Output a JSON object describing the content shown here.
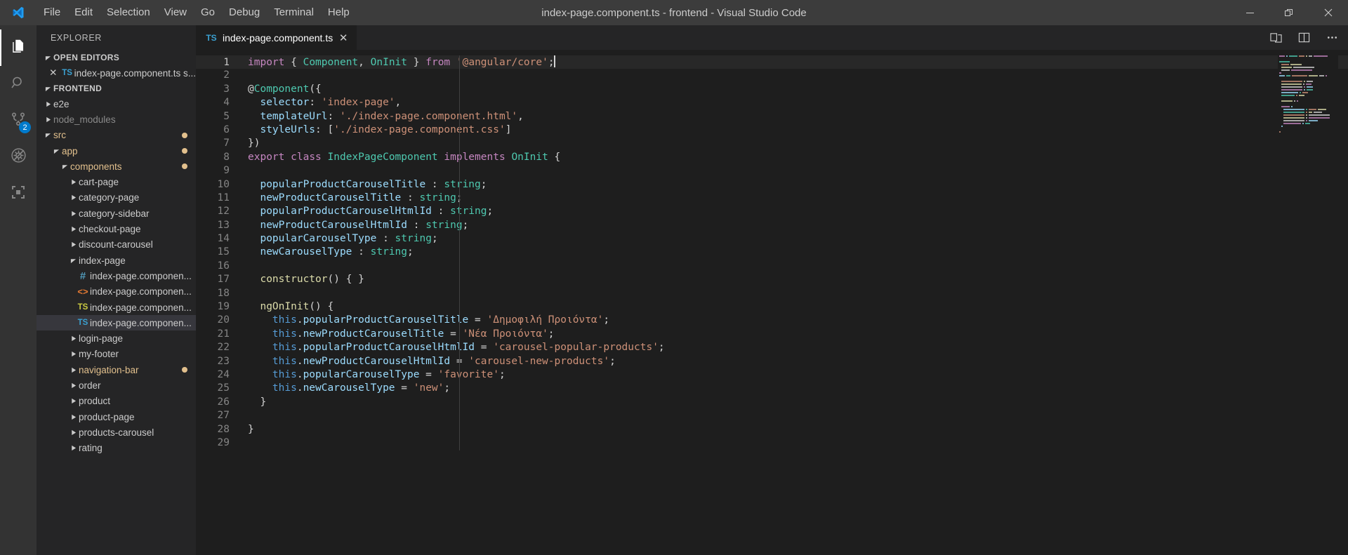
{
  "window": {
    "title": "index-page.component.ts - frontend - Visual Studio Code",
    "minimize_label": "Minimize",
    "restore_label": "Restore",
    "close_label": "Close"
  },
  "menu": {
    "items": [
      {
        "label": "File"
      },
      {
        "label": "Edit"
      },
      {
        "label": "Selection"
      },
      {
        "label": "View"
      },
      {
        "label": "Go"
      },
      {
        "label": "Debug"
      },
      {
        "label": "Terminal"
      },
      {
        "label": "Help"
      }
    ]
  },
  "activitybar": {
    "items": [
      {
        "name": "explorer",
        "icon": "files-icon",
        "active": true,
        "badge": ""
      },
      {
        "name": "search",
        "icon": "search-icon",
        "active": false,
        "badge": ""
      },
      {
        "name": "source-control",
        "icon": "source-control-icon",
        "active": false,
        "badge": "2"
      },
      {
        "name": "run-debug",
        "icon": "debug-no-icon",
        "active": false,
        "badge": ""
      },
      {
        "name": "extensions",
        "icon": "extensions-icon",
        "active": false,
        "badge": ""
      }
    ]
  },
  "sidebar": {
    "title": "EXPLORER",
    "open_editors": {
      "header": "OPEN EDITORS",
      "items": [
        {
          "label": "index-page.component.ts s...",
          "icon": "ts",
          "close": "✕"
        }
      ]
    },
    "folder": {
      "header": "FRONTEND",
      "tree": [
        {
          "label": "e2e",
          "indent": 1,
          "type": "folder",
          "state": "collapsed",
          "style": "normal",
          "dot": false
        },
        {
          "label": "node_modules",
          "indent": 1,
          "type": "folder",
          "state": "collapsed",
          "style": "dim",
          "dot": false
        },
        {
          "label": "src",
          "indent": 1,
          "type": "folder",
          "state": "expanded",
          "style": "mod",
          "dot": true
        },
        {
          "label": "app",
          "indent": 2,
          "type": "folder",
          "state": "expanded",
          "style": "mod",
          "dot": true
        },
        {
          "label": "components",
          "indent": 3,
          "type": "folder",
          "state": "expanded",
          "style": "mod",
          "dot": true
        },
        {
          "label": "cart-page",
          "indent": 4,
          "type": "folder",
          "state": "collapsed",
          "style": "normal",
          "dot": false
        },
        {
          "label": "category-page",
          "indent": 4,
          "type": "folder",
          "state": "collapsed",
          "style": "normal",
          "dot": false
        },
        {
          "label": "category-sidebar",
          "indent": 4,
          "type": "folder",
          "state": "collapsed",
          "style": "normal",
          "dot": false
        },
        {
          "label": "checkout-page",
          "indent": 4,
          "type": "folder",
          "state": "collapsed",
          "style": "normal",
          "dot": false
        },
        {
          "label": "discount-carousel",
          "indent": 4,
          "type": "folder",
          "state": "collapsed",
          "style": "normal",
          "dot": false
        },
        {
          "label": "index-page",
          "indent": 4,
          "type": "folder",
          "state": "expanded",
          "style": "normal",
          "dot": false
        },
        {
          "label": "index-page.componen...",
          "indent": 5,
          "type": "file",
          "icon": "css",
          "style": "normal",
          "dot": false
        },
        {
          "label": "index-page.componen...",
          "indent": 5,
          "type": "file",
          "icon": "html",
          "style": "normal",
          "dot": false
        },
        {
          "label": "index-page.componen...",
          "indent": 5,
          "type": "file",
          "icon": "tsspec",
          "style": "normal",
          "dot": false
        },
        {
          "label": "index-page.componen...",
          "indent": 5,
          "type": "file",
          "icon": "ts",
          "style": "normal",
          "dot": false,
          "selected": true
        },
        {
          "label": "login-page",
          "indent": 4,
          "type": "folder",
          "state": "collapsed",
          "style": "normal",
          "dot": false
        },
        {
          "label": "my-footer",
          "indent": 4,
          "type": "folder",
          "state": "collapsed",
          "style": "normal",
          "dot": false
        },
        {
          "label": "navigation-bar",
          "indent": 4,
          "type": "folder",
          "state": "collapsed",
          "style": "mod",
          "dot": true
        },
        {
          "label": "order",
          "indent": 4,
          "type": "folder",
          "state": "collapsed",
          "style": "normal",
          "dot": false
        },
        {
          "label": "product",
          "indent": 4,
          "type": "folder",
          "state": "collapsed",
          "style": "normal",
          "dot": false
        },
        {
          "label": "product-page",
          "indent": 4,
          "type": "folder",
          "state": "collapsed",
          "style": "normal",
          "dot": false
        },
        {
          "label": "products-carousel",
          "indent": 4,
          "type": "folder",
          "state": "collapsed",
          "style": "normal",
          "dot": false
        },
        {
          "label": "rating",
          "indent": 4,
          "type": "folder",
          "state": "collapsed",
          "style": "normal",
          "dot": false
        }
      ]
    }
  },
  "editor": {
    "tab": {
      "label": "index-page.component.ts",
      "icon": "TS",
      "close": "✕",
      "dirty": false
    },
    "tab_actions": [
      {
        "name": "split-editor-icon"
      },
      {
        "name": "open-changes-icon"
      },
      {
        "name": "more-actions-icon"
      }
    ],
    "filename": "index-page.component.ts",
    "cursor_line": 1,
    "lines": [
      {
        "n": 1,
        "text": "import { Component, OnInit } from '@angular/core';"
      },
      {
        "n": 2,
        "text": ""
      },
      {
        "n": 3,
        "text": "@Component({"
      },
      {
        "n": 4,
        "text": "  selector: 'index-page',"
      },
      {
        "n": 5,
        "text": "  templateUrl: './index-page.component.html',"
      },
      {
        "n": 6,
        "text": "  styleUrls: ['./index-page.component.css']"
      },
      {
        "n": 7,
        "text": "})"
      },
      {
        "n": 8,
        "text": "export class IndexPageComponent implements OnInit {"
      },
      {
        "n": 9,
        "text": ""
      },
      {
        "n": 10,
        "text": "  popularProductCarouselTitle : string;"
      },
      {
        "n": 11,
        "text": "  newProductCarouselTitle : string;"
      },
      {
        "n": 12,
        "text": "  popularProductCarouselHtmlId : string;"
      },
      {
        "n": 13,
        "text": "  newProductCarouselHtmlId : string;"
      },
      {
        "n": 14,
        "text": "  popularCarouselType : string;"
      },
      {
        "n": 15,
        "text": "  newCarouselType : string;"
      },
      {
        "n": 16,
        "text": ""
      },
      {
        "n": 17,
        "text": "  constructor() { }"
      },
      {
        "n": 18,
        "text": ""
      },
      {
        "n": 19,
        "text": "  ngOnInit() {"
      },
      {
        "n": 20,
        "text": "    this.popularProductCarouselTitle = 'Δημοφιλή Προιόντα';"
      },
      {
        "n": 21,
        "text": "    this.newProductCarouselTitle = 'Νέα Προιόντα';"
      },
      {
        "n": 22,
        "text": "    this.popularProductCarouselHtmlId = 'carousel-popular-products';"
      },
      {
        "n": 23,
        "text": "    this.newProductCarouselHtmlId = 'carousel-new-products';"
      },
      {
        "n": 24,
        "text": "    this.popularCarouselType = 'favorite';"
      },
      {
        "n": 25,
        "text": "    this.newCarouselType = 'new';"
      },
      {
        "n": 26,
        "text": "  }"
      },
      {
        "n": 27,
        "text": ""
      },
      {
        "n": 28,
        "text": "}"
      },
      {
        "n": 29,
        "text": ""
      }
    ]
  },
  "colors": {
    "titlebar_bg": "#3c3c3c",
    "activitybar_bg": "#333333",
    "sidebar_bg": "#252526",
    "editor_bg": "#1e1e1e",
    "accent": "#007acc",
    "modified": "#e2c08d",
    "keyword": "#c586c0",
    "type": "#4ec9b0",
    "string": "#ce9178",
    "variable": "#9cdcfe",
    "function": "#dcdcaa",
    "blue": "#569cd6"
  }
}
